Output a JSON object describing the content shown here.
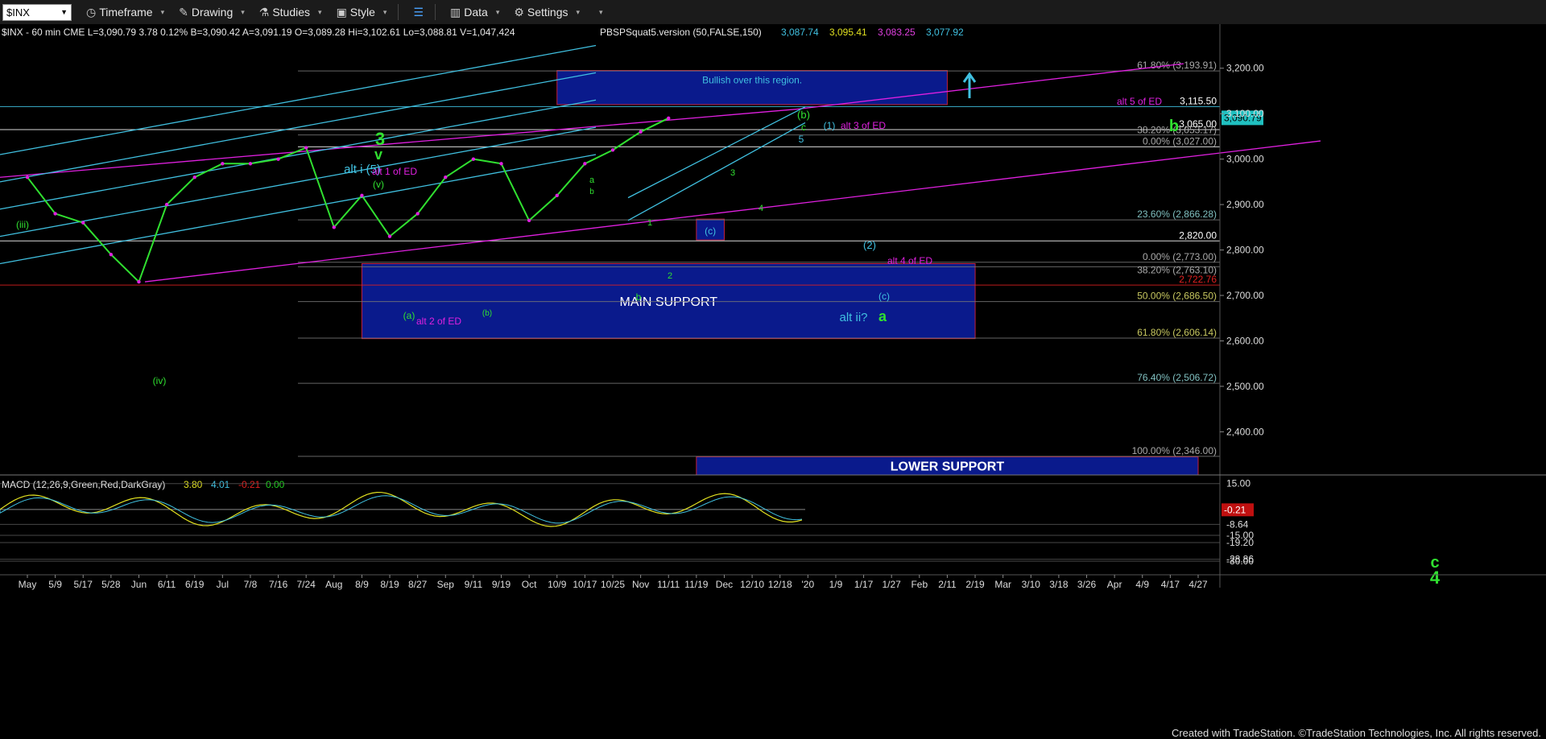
{
  "toolbar": {
    "symbol": "$INX",
    "timeframe": "Timeframe",
    "drawing": "Drawing",
    "studies": "Studies",
    "style": "Style",
    "data": "Data",
    "settings": "Settings"
  },
  "header": {
    "line1": "$INX - 60 min  CME  L=3,090.79  3.78   0.12%  B=3,090.42  A=3,091.19  O=3,089.28  Hi=3,102.61  Lo=3,088.81  V=1,047,424",
    "study": "PBSPSquat5.version (50,FALSE,150)",
    "study_values": [
      "3,087.74",
      "3,095.41",
      "3,083.25",
      "3,077.92"
    ]
  },
  "colors": {
    "magenta": "#e020e0",
    "cyan": "#40c0e0",
    "green": "#30e030",
    "navy": "#0a1a8c",
    "macd_red": "#e02020",
    "macd_green": "#20d020",
    "price_bg": "#20c0c0"
  },
  "chart_data": {
    "type": "line",
    "title": "$INX - 60 min",
    "x_tick_labels": [
      "May",
      "5/9",
      "5/17",
      "5/28",
      "Jun",
      "6/11",
      "6/19",
      "Jul",
      "7/8",
      "7/16",
      "7/24",
      "Aug",
      "8/9",
      "8/19",
      "8/27",
      "Sep",
      "9/11",
      "9/19",
      "Oct",
      "10/9",
      "10/17",
      "10/25",
      "Nov",
      "11/11",
      "11/19",
      "Dec",
      "12/10",
      "12/18",
      "'20",
      "1/9",
      "1/17",
      "1/27",
      "Feb",
      "2/11",
      "2/19",
      "Mar",
      "3/10",
      "3/18",
      "3/26",
      "Apr",
      "4/9",
      "4/17",
      "4/27"
    ],
    "y_tick_labels": [
      "3,200.00",
      "3,100.00",
      "3,000.00",
      "2,900.00",
      "2,800.00",
      "2,700.00",
      "2,600.00",
      "2,500.00",
      "2,400.00"
    ],
    "ylim": [
      2305,
      3258
    ],
    "price_series": [
      [
        "May",
        2960
      ],
      [
        "5/9",
        2880
      ],
      [
        "5/17",
        2860
      ],
      [
        "5/28",
        2790
      ],
      [
        "Jun",
        2730
      ],
      [
        "6/11",
        2900
      ],
      [
        "6/19",
        2960
      ],
      [
        "Jul",
        2990
      ],
      [
        "7/8",
        2990
      ],
      [
        "7/16",
        3000
      ],
      [
        "7/24",
        3025
      ],
      [
        "Aug",
        2850
      ],
      [
        "8/9",
        2920
      ],
      [
        "8/19",
        2830
      ],
      [
        "8/27",
        2880
      ],
      [
        "Sep",
        2960
      ],
      [
        "9/11",
        3000
      ],
      [
        "9/19",
        2990
      ],
      [
        "Oct",
        2865
      ],
      [
        "10/9",
        2920
      ],
      [
        "10/17",
        2990
      ],
      [
        "10/25",
        3020
      ],
      [
        "Nov",
        3060
      ],
      [
        "11/11",
        3090
      ]
    ],
    "last_price": "3,090.79",
    "price_levels": [
      {
        "label": "61.80% (3,193.91)",
        "value": 3193.91
      },
      {
        "label": "3,115.50",
        "value": 3115.5
      },
      {
        "label": "3,065.00",
        "value": 3065
      },
      {
        "label": "38.20% (3,053.17)",
        "value": 3053.17
      },
      {
        "label": "0.00% (3,027.00)",
        "value": 3027
      },
      {
        "label": "23.60% (2,866.28)",
        "value": 2866.28
      },
      {
        "label": "2,820.00",
        "value": 2820
      },
      {
        "label": "0.00% (2,773.00)",
        "value": 2773
      },
      {
        "label": "38.20% (2,763.10)",
        "value": 2763.1
      },
      {
        "label": "2,722.76",
        "value": 2722.76
      },
      {
        "label": "50.00% (2,686.50)",
        "value": 2686.5
      },
      {
        "label": "61.80% (2,606.14)",
        "value": 2606.14
      },
      {
        "label": "76.40% (2,506.72)",
        "value": 2506.72
      },
      {
        "label": "100.00% (2,346.00)",
        "value": 2346
      }
    ],
    "zones": [
      {
        "label": "Bullish over this region.",
        "from": 3120,
        "to": 3195,
        "x0": "10/9",
        "x1": "2/11"
      },
      {
        "label": "MAIN SUPPORT",
        "from": 2605,
        "to": 2770,
        "x0": "8/9",
        "x1": "2/19"
      },
      {
        "label": "LOWER SUPPORT",
        "from": 2305,
        "to": 2345,
        "x0": "11/19",
        "x1": "4/27"
      },
      {
        "label": "(c)",
        "from": 2822,
        "to": 2868,
        "x0": "11/19",
        "x1": "Dec"
      }
    ],
    "annotations": [
      "3",
      "v",
      "alt i (5)",
      "alt 1 of ED",
      "(v)",
      "(iii)",
      "(iv)",
      "(a)",
      "(b)",
      "alt 2 of ED",
      "(b)",
      "c",
      "5",
      "(1)",
      "alt 3 of ED",
      "alt 5 of ED",
      "b",
      "(2)",
      "alt 4 of ED",
      "alt ii?",
      "a",
      "(c)",
      "3",
      "4",
      "1",
      "2",
      "b",
      "a",
      "b",
      "c",
      "4"
    ],
    "macd": {
      "label": "MACD (12,26,9,Green,Red,DarkGray)",
      "values": [
        "3.80",
        "4.01",
        "-0.21",
        "0.00"
      ],
      "y_tick_labels": [
        "15.00",
        "-8.64",
        "-15.00",
        "-19.20",
        "-28.86",
        "-30.00"
      ],
      "last_value": "-0.21",
      "ylim": [
        -36,
        20
      ]
    }
  },
  "footer": "Created with TradeStation. ©TradeStation Technologies, Inc. All rights reserved."
}
